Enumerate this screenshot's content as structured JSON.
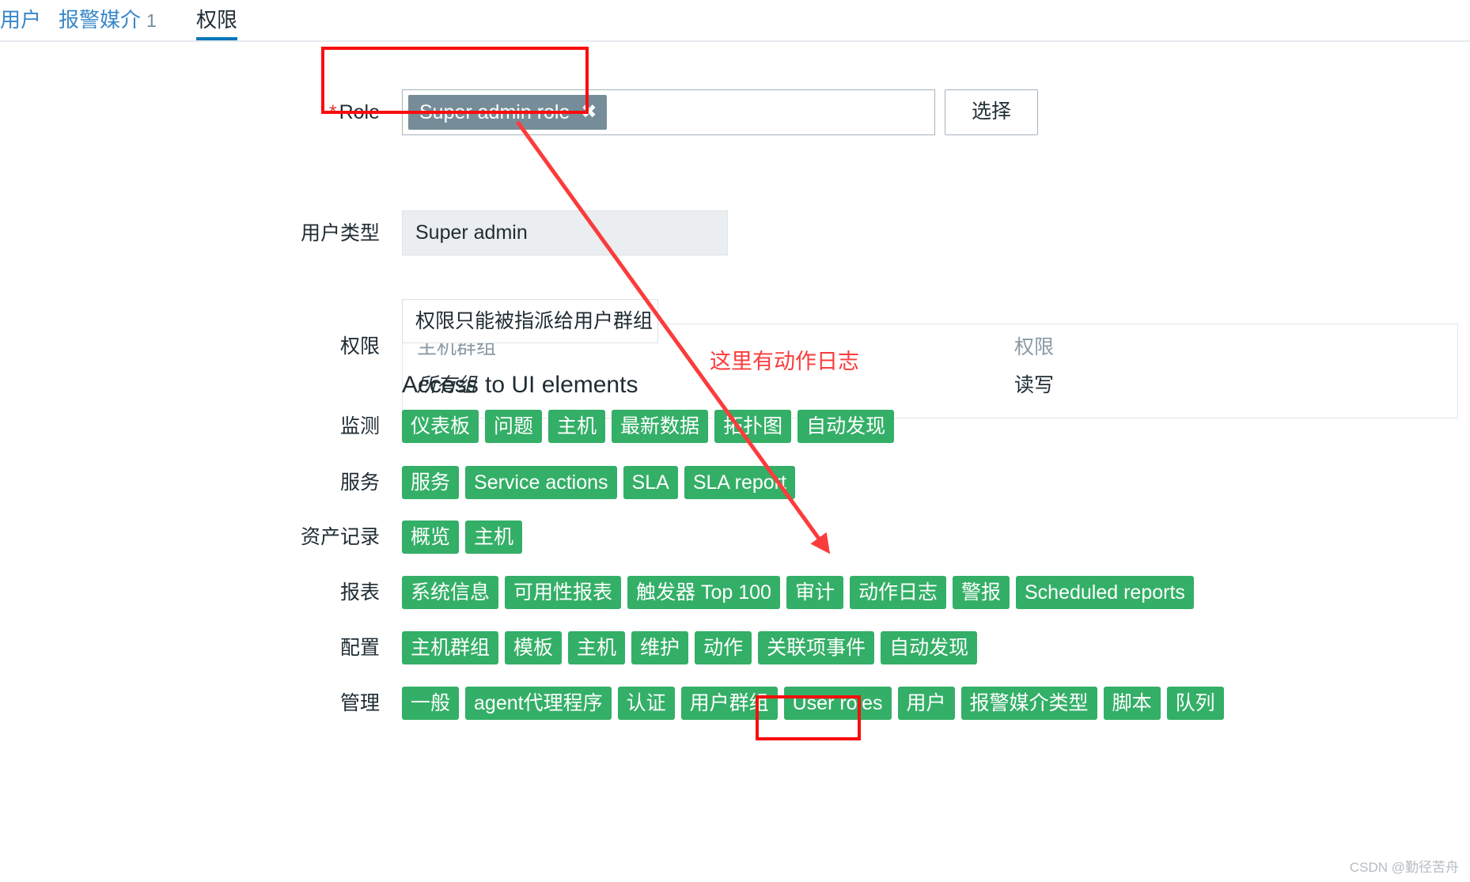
{
  "tabs": [
    {
      "label": "用户",
      "count": "",
      "active": false
    },
    {
      "label": "报警媒介",
      "count": "1",
      "active": false
    },
    {
      "label": "权限",
      "count": "",
      "active": true
    }
  ],
  "form": {
    "role": {
      "required_marker": "*",
      "label": "Role",
      "chip_value": "Super admin role",
      "chip_remove_icon": "✖",
      "select_button": "选择"
    },
    "user_type": {
      "label": "用户类型",
      "value": "Super admin"
    },
    "permissions": {
      "label": "权限",
      "columns": [
        "主机群组",
        "权限"
      ],
      "rows": [
        {
          "host_group": "所有组",
          "permission": "读写"
        }
      ]
    },
    "notice": "权限只能被指派给用户群组"
  },
  "ui_access": {
    "heading": "Access to UI elements",
    "groups": [
      {
        "label": "监测",
        "items": [
          "仪表板",
          "问题",
          "主机",
          "最新数据",
          "拓扑图",
          "自动发现"
        ]
      },
      {
        "label": "服务",
        "items": [
          "服务",
          "Service actions",
          "SLA",
          "SLA report"
        ]
      },
      {
        "label": "资产记录",
        "items": [
          "概览",
          "主机"
        ]
      },
      {
        "label": "报表",
        "items": [
          "系统信息",
          "可用性报表",
          "触发器 Top 100",
          "审计",
          "动作日志",
          "警报",
          "Scheduled reports"
        ]
      },
      {
        "label": "配置",
        "items": [
          "主机群组",
          "模板",
          "主机",
          "维护",
          "动作",
          "关联项事件",
          "自动发现"
        ]
      },
      {
        "label": "管理",
        "items": [
          "一般",
          "agent代理程序",
          "认证",
          "用户群组",
          "User roles",
          "用户",
          "报警媒介类型",
          "脚本",
          "队列"
        ]
      }
    ]
  },
  "annotations": {
    "note_text": "这里有动作日志",
    "highlight_color": "#fb0d0d",
    "arrow_color": "#fb3c3c"
  },
  "watermark": "CSDN @勤径苦舟",
  "colors": {
    "badge_green": "#34af67",
    "chip_gray": "#768d99",
    "tab_link_blue": "#3887c8",
    "tab_active_underline": "#0275b8"
  }
}
